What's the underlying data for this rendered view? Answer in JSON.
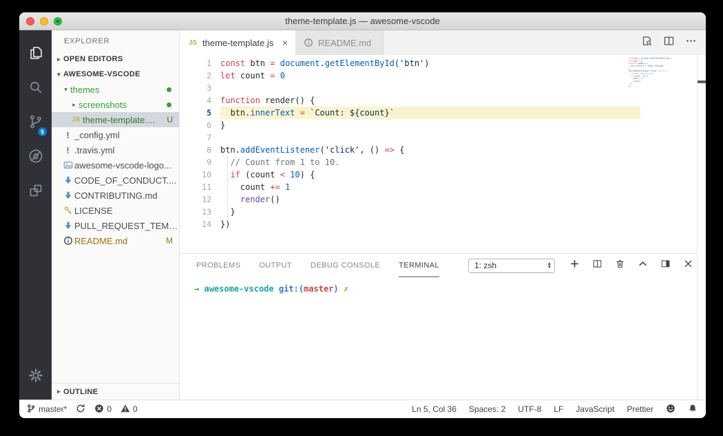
{
  "window": {
    "title": "theme-template.js — awesome-vscode"
  },
  "colors": {
    "accent": "#007acc",
    "badge": "#007acc",
    "activity_bar_bg": "#2f3136",
    "git_added_green": "#34a234",
    "git_modified_orange": "#a1700a",
    "keyword_red": "#d73a49",
    "constant_blue": "#005cc5",
    "string_navy": "#032f62",
    "comment_gray": "#6a737d",
    "function_purple": "#6f42c1",
    "current_line_highlight": "#fbf3cd",
    "selected_row": "#d4d8de"
  },
  "activity_bar": {
    "items": [
      {
        "name": "explorer",
        "icon": "files-icon",
        "active": true
      },
      {
        "name": "search",
        "icon": "search-icon",
        "active": false
      },
      {
        "name": "source-control",
        "icon": "source-control-icon",
        "active": false,
        "badge": "5"
      },
      {
        "name": "debug",
        "icon": "debug-icon",
        "active": false
      },
      {
        "name": "extensions",
        "icon": "extensions-icon",
        "active": false
      }
    ],
    "settings": {
      "name": "settings",
      "icon": "gear-icon"
    }
  },
  "sidebar": {
    "title": "EXPLORER",
    "sections": [
      {
        "label": "OPEN EDITORS",
        "expanded": false
      },
      {
        "label": "AWESOME-VSCODE",
        "expanded": true
      }
    ],
    "tree": [
      {
        "label": "themes",
        "chevron": "down",
        "indent": 1,
        "color": "green",
        "badge": "dot"
      },
      {
        "label": "screenshots",
        "chevron": "right",
        "indent": 2,
        "color": "green",
        "badge": "dot"
      },
      {
        "label": "theme-template....",
        "icon": "js-icon",
        "indent": 2,
        "color": "greendark",
        "badge": "U",
        "selected": true
      },
      {
        "label": "_config.yml",
        "icon": "exclaim-icon",
        "indent": 1
      },
      {
        "label": ".travis.yml",
        "icon": "exclaim-icon",
        "indent": 1
      },
      {
        "label": "awesome-vscode-logo...",
        "icon": "image-icon",
        "indent": 1
      },
      {
        "label": "CODE_OF_CONDUCT....",
        "icon": "markdown-icon",
        "indent": 1
      },
      {
        "label": "CONTRIBUTING.md",
        "icon": "markdown-icon",
        "indent": 1
      },
      {
        "label": "LICENSE",
        "icon": "key-icon",
        "indent": 1
      },
      {
        "label": "PULL_REQUEST_TEMP...",
        "icon": "markdown-icon",
        "indent": 1
      },
      {
        "label": "README.md",
        "icon": "info-icon",
        "indent": 1,
        "color": "orange",
        "badge": "M"
      }
    ],
    "outline": {
      "label": "OUTLINE",
      "expanded": false
    }
  },
  "editor": {
    "tabs": [
      {
        "label": "theme-template.js",
        "icon": "js-icon",
        "active": true,
        "close_glyph": "×"
      },
      {
        "label": "README.md",
        "icon": "info-icon",
        "active": false
      }
    ],
    "actions": [
      {
        "name": "search-in-file",
        "icon": "search-file-icon"
      },
      {
        "name": "split-editor",
        "icon": "split-icon"
      },
      {
        "name": "more-actions",
        "icon": "ellipsis-icon"
      }
    ],
    "current_line": 5,
    "lines": [
      {
        "n": 1,
        "t": [
          [
            "k",
            "const"
          ],
          [
            "n",
            " btn "
          ],
          [
            "k",
            "="
          ],
          [
            "n",
            " "
          ],
          [
            "v",
            "document"
          ],
          [
            "n",
            "."
          ],
          [
            "v",
            "getElementById"
          ],
          [
            "n",
            "("
          ],
          [
            "s",
            "'btn'"
          ],
          [
            "n",
            ")"
          ]
        ]
      },
      {
        "n": 2,
        "t": [
          [
            "k",
            "let"
          ],
          [
            "n",
            " count "
          ],
          [
            "k",
            "="
          ],
          [
            "n",
            " "
          ],
          [
            "v",
            "0"
          ]
        ]
      },
      {
        "n": 3,
        "t": []
      },
      {
        "n": 4,
        "t": [
          [
            "k",
            "function"
          ],
          [
            "n",
            " render() {"
          ]
        ]
      },
      {
        "n": 5,
        "t": [
          [
            "n",
            "  btn."
          ],
          [
            "v",
            "innerText"
          ],
          [
            "n",
            " "
          ],
          [
            "k",
            "="
          ],
          [
            "n",
            " "
          ],
          [
            "s",
            "`Count: ${count}`"
          ]
        ],
        "hl": true,
        "g": true
      },
      {
        "n": 6,
        "t": [
          [
            "n",
            "}"
          ]
        ]
      },
      {
        "n": 7,
        "t": []
      },
      {
        "n": 8,
        "t": [
          [
            "n",
            "btn."
          ],
          [
            "v",
            "addEventListener"
          ],
          [
            "n",
            "("
          ],
          [
            "s",
            "'click'"
          ],
          [
            "n",
            ", () "
          ],
          [
            "k",
            "=>"
          ],
          [
            "n",
            " {"
          ]
        ]
      },
      {
        "n": 9,
        "t": [
          [
            "c",
            "  // Count from 1 to 10."
          ]
        ],
        "g": true
      },
      {
        "n": 10,
        "t": [
          [
            "n",
            "  "
          ],
          [
            "k",
            "if"
          ],
          [
            "n",
            " (count "
          ],
          [
            "k",
            "<"
          ],
          [
            "n",
            " "
          ],
          [
            "v",
            "10"
          ],
          [
            "n",
            ") {"
          ]
        ],
        "g": true
      },
      {
        "n": 11,
        "t": [
          [
            "n",
            "    count "
          ],
          [
            "k",
            "+="
          ],
          [
            "n",
            " "
          ],
          [
            "v",
            "1"
          ]
        ],
        "g": true
      },
      {
        "n": 12,
        "t": [
          [
            "n",
            "    "
          ],
          [
            "f",
            "render"
          ],
          [
            "n",
            "()"
          ]
        ],
        "g": true
      },
      {
        "n": 13,
        "t": [
          [
            "n",
            "  }"
          ]
        ],
        "g": true
      },
      {
        "n": 14,
        "t": [
          [
            "n",
            "})"
          ]
        ]
      }
    ]
  },
  "panel": {
    "tabs": [
      {
        "label": "PROBLEMS",
        "active": false
      },
      {
        "label": "OUTPUT",
        "active": false
      },
      {
        "label": "DEBUG CONSOLE",
        "active": false
      },
      {
        "label": "TERMINAL",
        "active": true
      }
    ],
    "terminal_select": "1: zsh",
    "actions": [
      {
        "name": "new-terminal",
        "icon": "plus-icon"
      },
      {
        "name": "split-terminal",
        "icon": "split-icon"
      },
      {
        "name": "kill-terminal",
        "icon": "trash-icon"
      },
      {
        "name": "maximize-panel",
        "icon": "chevron-up-icon"
      },
      {
        "name": "move-panel",
        "icon": "panel-right-icon"
      },
      {
        "name": "close-panel",
        "icon": "close-icon"
      }
    ],
    "terminal_prompt": [
      [
        "green",
        "→"
      ],
      [
        "plain",
        "  "
      ],
      [
        "cyan",
        "awesome-vscode"
      ],
      [
        "plain",
        " "
      ],
      [
        "blue",
        "git:("
      ],
      [
        "red",
        "master"
      ],
      [
        "blue",
        ")"
      ],
      [
        "plain",
        " "
      ],
      [
        "yellow",
        "✗"
      ]
    ]
  },
  "status_bar": {
    "left": [
      {
        "name": "git-branch",
        "icon": "branch-icon",
        "label": "master*"
      },
      {
        "name": "sync",
        "icon": "sync-icon",
        "label": ""
      },
      {
        "name": "errors",
        "icon": "error-icon",
        "label": "0"
      },
      {
        "name": "warnings",
        "icon": "warning-icon",
        "label": "0"
      }
    ],
    "right": [
      {
        "name": "cursor-position",
        "label": "Ln 5, Col 36"
      },
      {
        "name": "indentation",
        "label": "Spaces: 2"
      },
      {
        "name": "encoding",
        "label": "UTF-8"
      },
      {
        "name": "eol",
        "label": "LF"
      },
      {
        "name": "language-mode",
        "label": "JavaScript"
      },
      {
        "name": "formatter",
        "label": "Prettier"
      },
      {
        "name": "feedback",
        "icon": "smiley-icon",
        "label": ""
      },
      {
        "name": "notifications",
        "icon": "bell-icon",
        "label": ""
      }
    ]
  }
}
